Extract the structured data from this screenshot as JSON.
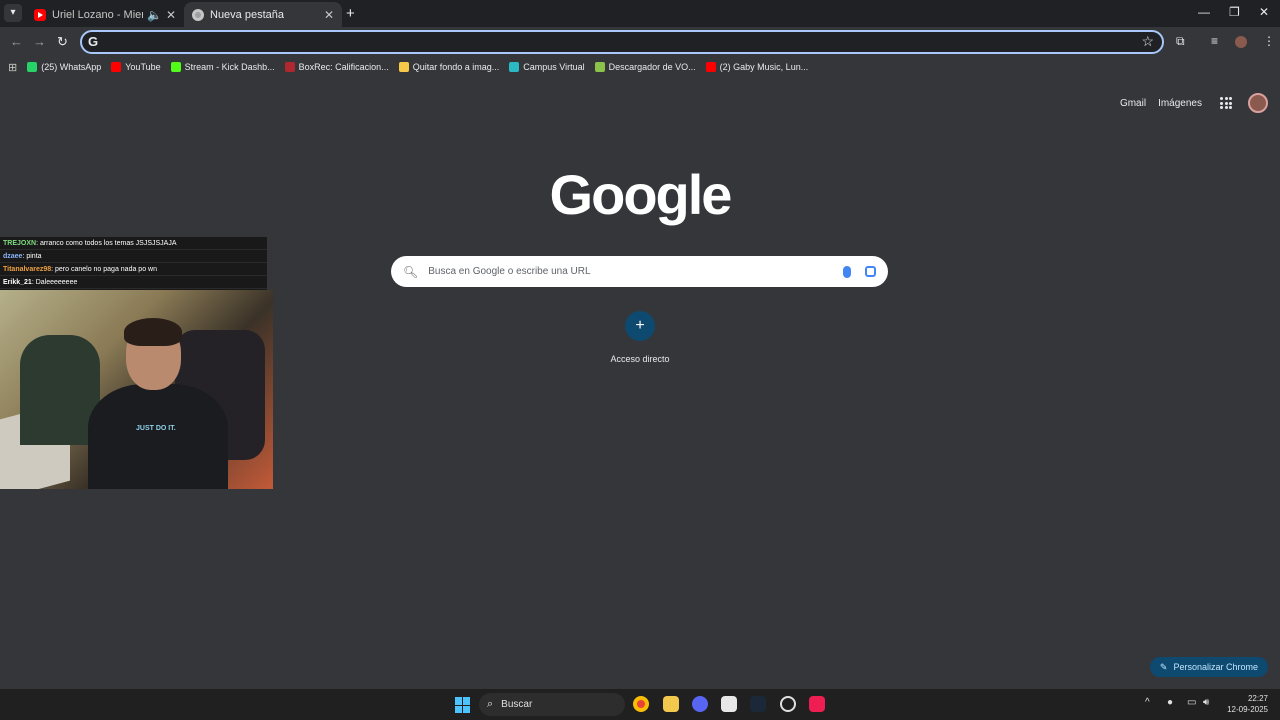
{
  "tabs": [
    {
      "title": "Uriel Lozano - Mientes Al D...",
      "icon": "youtube-icon",
      "audio": "speaker-icon"
    },
    {
      "title": "Nueva pestaña",
      "icon": "chrome-icon"
    }
  ],
  "bookmarks": [
    {
      "label": "(25) WhatsApp",
      "color": "#25d366"
    },
    {
      "label": "YouTube",
      "color": "#ff0000"
    },
    {
      "label": "Stream - Kick Dashb...",
      "color": "#53fc18"
    },
    {
      "label": "BoxRec: Calificacion...",
      "color": "#b0282f"
    },
    {
      "label": "Quitar fondo a imag...",
      "color": "#f7c948"
    },
    {
      "label": "Campus Virtual",
      "color": "#2bb9c4"
    },
    {
      "label": "Descargador de VO...",
      "color": "#8bc34a"
    },
    {
      "label": "(2) Gaby Music, Lun...",
      "color": "#ff0000"
    }
  ],
  "page": {
    "gmail": "Gmail",
    "images": "Imágenes",
    "logo": "Google",
    "search_placeholder": "Busca en Google o escribe una URL",
    "shortcut_label": "Acceso directo",
    "customize": "Personalizar Chrome"
  },
  "chat": [
    {
      "user": "TREJOXN",
      "msg": ": arranco como todos los temas JSJSJSJAJA",
      "color": "#7fdc7f"
    },
    {
      "user": "dzaee",
      "msg": ": pinta",
      "color": "#8ab4f8"
    },
    {
      "user": "Titanalvarez98",
      "msg": ": pero canelo no paga nada po wn",
      "color": "#f0a040"
    },
    {
      "user": "Erikk_21",
      "msg": ": Daleeeeeeee",
      "color": "#ffffff"
    }
  ],
  "webcam": {
    "shirt_text": "JUST DO IT."
  },
  "taskbar": {
    "search": "Buscar",
    "time": "22:27",
    "date": "12-09-2025"
  },
  "colors": {
    "accent": "#a8c7fa",
    "page_bg": "#35363a",
    "button_bg": "#0e4970"
  }
}
